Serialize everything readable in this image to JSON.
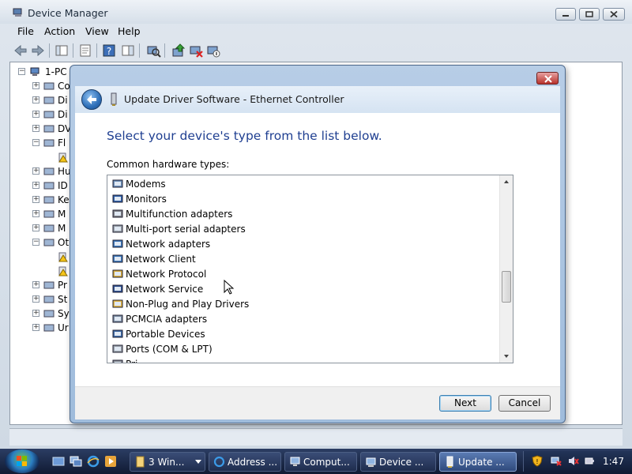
{
  "device_manager": {
    "title": "Device Manager",
    "menu": [
      "File",
      "Action",
      "View",
      "Help"
    ],
    "tree": {
      "root": "1-PC",
      "items": [
        {
          "label": "Co",
          "expander": "+"
        },
        {
          "label": "Di",
          "expander": "+"
        },
        {
          "label": "Di",
          "expander": "+"
        },
        {
          "label": "DV",
          "expander": "+"
        },
        {
          "label": "Fl",
          "expander": "−"
        },
        {
          "label": "",
          "expander": ""
        },
        {
          "label": "Hu",
          "expander": "+"
        },
        {
          "label": "ID",
          "expander": "+"
        },
        {
          "label": "Ke",
          "expander": "+"
        },
        {
          "label": "M",
          "expander": "+"
        },
        {
          "label": "M",
          "expander": "+"
        },
        {
          "label": "Ot",
          "expander": "−"
        },
        {
          "label": "",
          "expander": ""
        },
        {
          "label": "",
          "expander": ""
        },
        {
          "label": "Pr",
          "expander": "+"
        },
        {
          "label": "St",
          "expander": "+"
        },
        {
          "label": "Sy",
          "expander": "+"
        },
        {
          "label": "Ur",
          "expander": "+"
        }
      ]
    }
  },
  "dialog": {
    "title": "Update Driver Software - Ethernet Controller",
    "heading": "Select your device's type from the list below.",
    "list_label": "Common hardware types:",
    "items": [
      {
        "label": "Modems",
        "icon": "modem-icon"
      },
      {
        "label": "Monitors",
        "icon": "monitor-icon"
      },
      {
        "label": "Multifunction adapters",
        "icon": "multifunction-adapter-icon"
      },
      {
        "label": "Multi-port serial adapters",
        "icon": "serial-adapter-icon"
      },
      {
        "label": "Network adapters",
        "icon": "network-adapter-icon"
      },
      {
        "label": "Network Client",
        "icon": "network-client-icon"
      },
      {
        "label": "Network Protocol",
        "icon": "network-protocol-icon"
      },
      {
        "label": "Network Service",
        "icon": "network-service-icon"
      },
      {
        "label": "Non-Plug and Play Drivers",
        "icon": "non-pnp-driver-icon"
      },
      {
        "label": "PCMCIA adapters",
        "icon": "pcmcia-adapter-icon"
      },
      {
        "label": "Portable Devices",
        "icon": "portable-device-icon"
      },
      {
        "label": "Ports (COM & LPT)",
        "icon": "port-icon"
      },
      {
        "label": "Pri",
        "icon": "printer-icon"
      }
    ],
    "buttons": {
      "next": "Next",
      "cancel": "Cancel"
    }
  },
  "taskbar": {
    "buttons": [
      {
        "label": "3 Win...",
        "icon": "folder-icon"
      },
      {
        "label": "Address ...",
        "icon": "ie-icon"
      },
      {
        "label": "Comput...",
        "icon": "computer-icon"
      },
      {
        "label": "Device ...",
        "icon": "device-manager-icon"
      },
      {
        "label": "Update ...",
        "icon": "update-driver-icon"
      }
    ],
    "clock": "1:47"
  }
}
